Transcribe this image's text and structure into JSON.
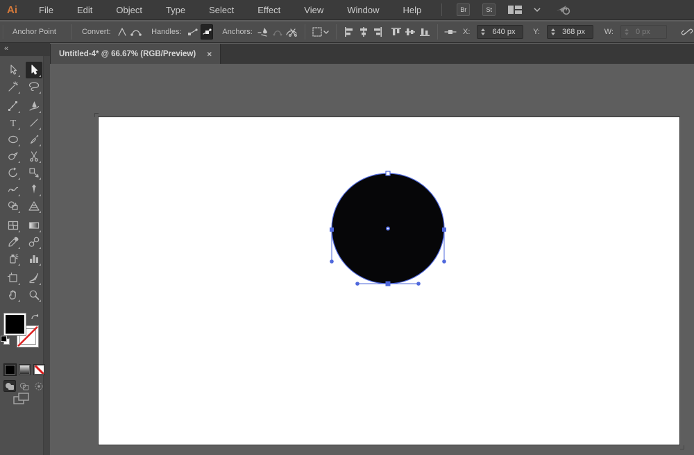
{
  "window": {
    "app": "Adobe Illustrator"
  },
  "menubar": {
    "logo": "Ai",
    "items": [
      "File",
      "Edit",
      "Object",
      "Type",
      "Select",
      "Effect",
      "View",
      "Window",
      "Help"
    ],
    "bridge_button": "Br",
    "stock_button": "St",
    "icons": [
      "workspace-switcher",
      "chevron-down",
      "cs-live-share"
    ]
  },
  "controlbar": {
    "context": "Anchor Point",
    "convert_label": "Convert:",
    "handles_label": "Handles:",
    "anchors_label": "Anchors:",
    "convert_buttons": [
      "convert-to-corner",
      "convert-to-smooth"
    ],
    "handles_buttons": [
      "hide-handles",
      "show-handles (selected)"
    ],
    "anchors_buttons": [
      "remove-selected-anchors",
      "connect-selected-endpoints (disabled)",
      "cut-path-at-anchors"
    ],
    "align_buttons": [
      "align-left",
      "align-h-center",
      "align-right",
      "align-top",
      "align-v-center",
      "align-bottom"
    ],
    "isolate_dropdown": "artboard-options",
    "handle-display": "anchor-handle-display",
    "x_label": "X:",
    "x_value": "640 px",
    "y_label": "Y:",
    "y_value": "368 px",
    "w_label": "W:",
    "w_value": "0 px",
    "link_icon": "unlink-dimensions"
  },
  "tabbar": {
    "title": "Untitled-4* @ 66.67% (RGB/Preview)",
    "close": "×"
  },
  "toolbar": {
    "collapse": "«",
    "tools": [
      "selection",
      "direct-selection (selected)",
      "magic-wand",
      "lasso",
      "pen",
      "curvature",
      "type",
      "line-segment",
      "ellipse",
      "paintbrush",
      "pencil",
      "scissors",
      "rotate",
      "scale",
      "width",
      "puppet-warp",
      "shape-builder",
      "perspective-grid",
      "mesh",
      "gradient",
      "eyedropper",
      "blend",
      "symbol-sprayer",
      "column-graph",
      "artboard",
      "slice",
      "hand",
      "zoom"
    ],
    "swatches": [
      "fill-black",
      "stroke-none",
      "swap-fill-stroke",
      "default-fill-stroke"
    ],
    "appearance_buttons": [
      "color",
      "gradient",
      "none"
    ],
    "drawing_modes": [
      "draw-normal (selected)",
      "draw-behind",
      "draw-inside"
    ],
    "screen_mode": "change-screen-mode"
  },
  "canvas": {
    "artboard": "white",
    "shape": "black filled circle, ellipse path selected",
    "selected_anchor": "bottom anchor with horizontal direction handles"
  },
  "colors": {
    "selection_blue": "#4f68dc",
    "logo_orange": "#d4793a",
    "fill": "#000000",
    "pasteboard": "#5e5e5e",
    "chrome": "#4d4d4d"
  }
}
